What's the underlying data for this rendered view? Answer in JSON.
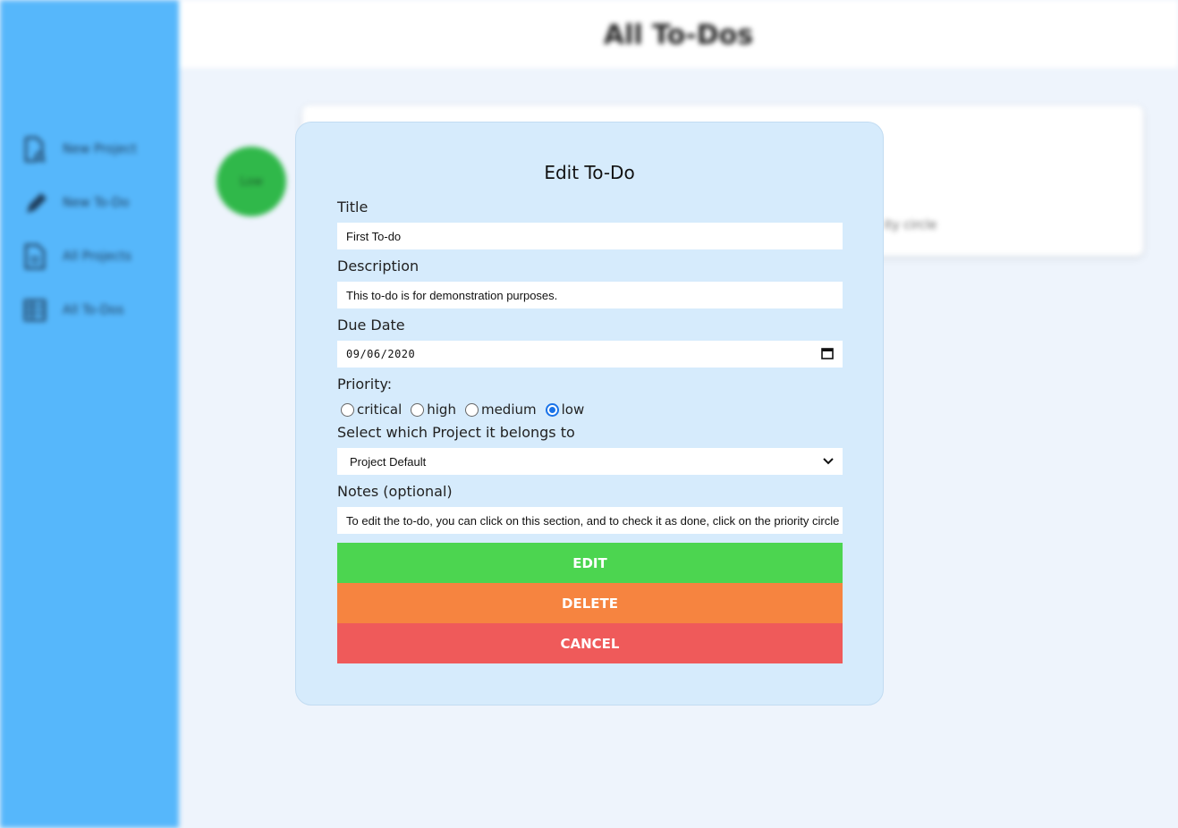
{
  "header": {
    "title": "All To-Dos"
  },
  "sidebar": {
    "items": [
      {
        "label": "New Project",
        "icon": "new-project-icon"
      },
      {
        "label": "New To-Do",
        "icon": "pencil-icon"
      },
      {
        "label": "All Projects",
        "icon": "document-icon"
      },
      {
        "label": "All To-Dos",
        "icon": "grid-list-icon"
      }
    ]
  },
  "todo_card": {
    "priority_badge": "Low",
    "hint_text": "ity circle"
  },
  "modal": {
    "title": "Edit To-Do",
    "title_label": "Title",
    "title_value": "First To-do",
    "description_label": "Description",
    "description_value": "This to-do is for demonstration purposes.",
    "due_date_label": "Due Date",
    "due_date_value": "09/06/2020",
    "priority_label": "Priority:",
    "priority_options": [
      "critical",
      "high",
      "medium",
      "low"
    ],
    "priority_selected": "low",
    "project_label": "Select which Project it belongs to",
    "project_value": "Project Default",
    "notes_label": "Notes (optional)",
    "notes_value": "To edit the to-do, you can click on this section, and to check it as done, click on the priority circle",
    "edit_label": "EDIT",
    "delete_label": "DELETE",
    "cancel_label": "CANCEL"
  },
  "colors": {
    "sidebar": "#56b7fb",
    "modal_bg": "#d6ebfc",
    "edit": "#4cd550",
    "delete": "#f68440",
    "cancel": "#ef5a5a",
    "priority_low": "#30b84a"
  }
}
